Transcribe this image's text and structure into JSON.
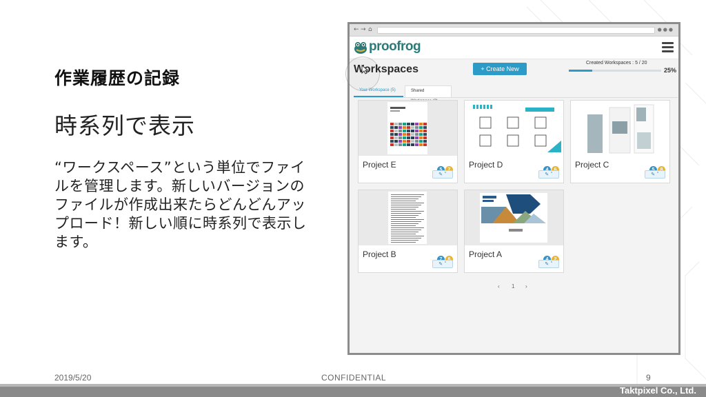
{
  "slide": {
    "title": "作業履歴の記録",
    "subtitle": "時系列で表示",
    "body": "“ワークスペース”という単位でファイルを管理します。新しいバージョンのファイルが作成出来たらどんどんアップロード！新しい順に時系列で表示します。",
    "footer": {
      "date": "2019/5/20",
      "confidential": "CONFIDENTIAL",
      "page": "9",
      "company": "Taktpixel Co., Ltd."
    }
  },
  "app": {
    "logo_text": "proofrog",
    "page_title": "Workspaces",
    "new_button": "+ Create New",
    "created_label": "Created Workspaces : 5 / 20",
    "progress_fraction": 0.25,
    "progress_text": "25%",
    "tabs": [
      "Your Workspace (5)",
      "Shared Workspace (2)"
    ],
    "projects": [
      {
        "name": "Project E",
        "v1": "5",
        "v2": "7"
      },
      {
        "name": "Project D",
        "v1": "4",
        "v2": "6"
      },
      {
        "name": "Project C",
        "v1": "5",
        "v2": "8"
      },
      {
        "name": "Project B",
        "v1": "7",
        "v2": "6"
      },
      {
        "name": "Project A",
        "v1": "4",
        "v2": "2"
      }
    ],
    "edit_glyph": "✎ ˅",
    "pagination": {
      "prev": "‹",
      "page": "1",
      "next": "›"
    }
  },
  "colors": {
    "accent": "#2c9bc7",
    "logo": "#2a7b79",
    "badge_blue": "#3a92c4",
    "badge_yellow": "#e5b43b",
    "footer_bar": "#8a8a8a"
  }
}
